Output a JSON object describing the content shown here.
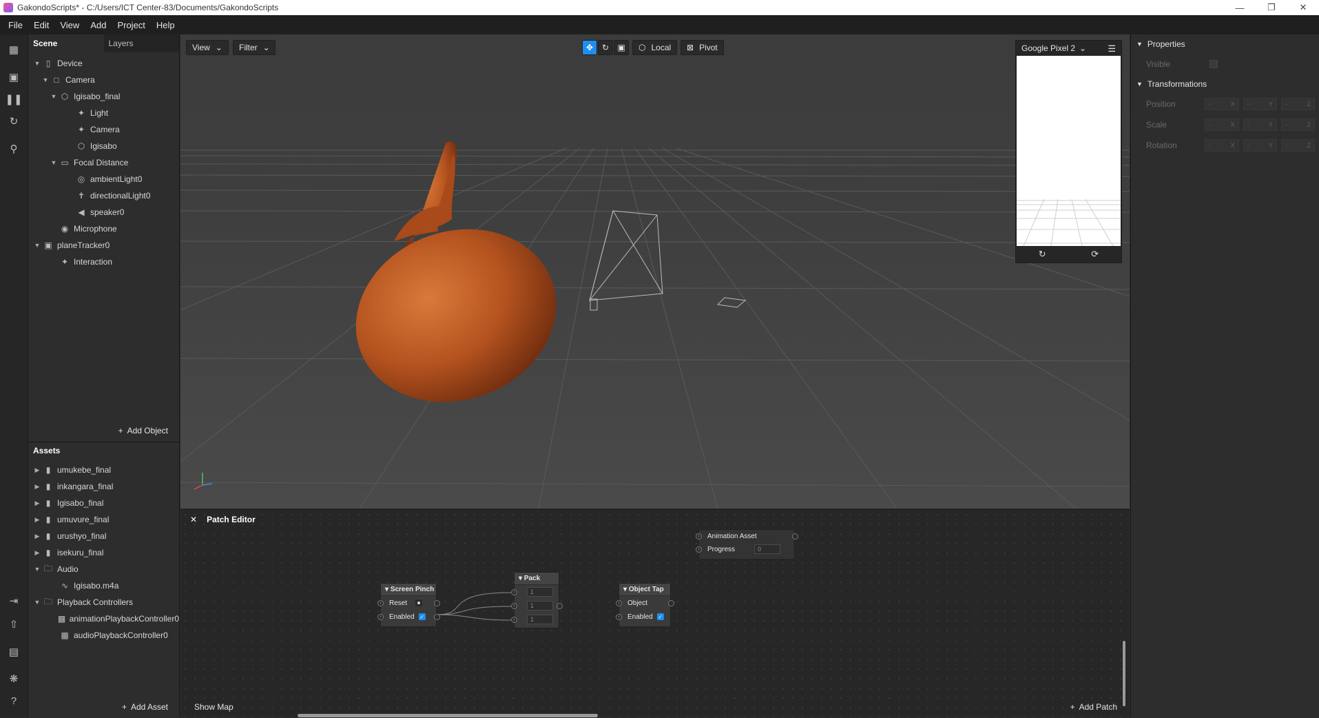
{
  "window": {
    "title": "GakondoScripts* - C:/Users/ICT Center-83/Documents/GakondoScripts"
  },
  "menu": [
    "File",
    "Edit",
    "View",
    "Add",
    "Project",
    "Help"
  ],
  "scene": {
    "tabs": [
      "Scene",
      "Layers"
    ],
    "tree": [
      {
        "label": "Device",
        "icon": "phone-icon"
      },
      {
        "label": "Camera",
        "icon": "camera-icon"
      },
      {
        "label": "Igisabo_final",
        "icon": "cube-icon"
      },
      {
        "label": "Light",
        "icon": "light-rig-icon"
      },
      {
        "label": "Camera",
        "icon": "camera-rig-icon"
      },
      {
        "label": "Igisabo",
        "icon": "mesh-icon"
      },
      {
        "label": "Focal Distance",
        "icon": "focal-distance-icon"
      },
      {
        "label": "ambientLight0",
        "icon": "ambient-light-icon"
      },
      {
        "label": "directionalLight0",
        "icon": "directional-light-icon"
      },
      {
        "label": "speaker0",
        "icon": "speaker-icon"
      },
      {
        "label": "Microphone",
        "icon": "microphone-icon"
      },
      {
        "label": "planeTracker0",
        "icon": "plane-tracker-icon"
      },
      {
        "label": "Interaction",
        "icon": "interaction-icon"
      }
    ],
    "add_object": "Add Object"
  },
  "assets": {
    "title": "Assets",
    "items": [
      {
        "label": "umukebe_final"
      },
      {
        "label": "inkangara_final"
      },
      {
        "label": "Igisabo_final"
      },
      {
        "label": "umuvure_final"
      },
      {
        "label": "urushyo_final"
      },
      {
        "label": "isekuru_final"
      },
      {
        "label": "Audio"
      },
      {
        "label": "Igisabo.m4a"
      },
      {
        "label": "Playback Controllers"
      },
      {
        "label": "animationPlaybackController0"
      },
      {
        "label": "audioPlaybackController0"
      }
    ],
    "add_asset": "Add Asset"
  },
  "viewport": {
    "view_label": "View",
    "filter_label": "Filter",
    "local_label": "Local",
    "pivot_label": "Pivot",
    "device_name": "Google Pixel 2"
  },
  "properties": {
    "title": "Properties",
    "visible_label": "Visible",
    "transformations_title": "Transformations",
    "rows": [
      {
        "label": "Position",
        "axes": [
          "X",
          "Y",
          "Z"
        ]
      },
      {
        "label": "Scale",
        "axes": [
          "X",
          "Y",
          "Z"
        ]
      },
      {
        "label": "Rotation",
        "axes": [
          "X",
          "Y",
          "Z"
        ]
      }
    ],
    "axis_placeholder": "-"
  },
  "patch_editor": {
    "title": "Patch Editor",
    "show_map": "Show Map",
    "add_patch": "Add Patch",
    "nodes": {
      "animation_asset": {
        "title": "Animation Asset",
        "progress_label": "Progress",
        "progress_value": "0"
      },
      "screen_pinch": {
        "title": "Screen Pinch",
        "reset_label": "Reset",
        "enabled_label": "Enabled"
      },
      "pack": {
        "title": "Pack",
        "values": [
          "1",
          "1",
          "1"
        ]
      },
      "object_tap": {
        "title": "Object Tap",
        "object_label": "Object",
        "enabled_label": "Enabled"
      }
    }
  },
  "colors": {
    "accent": "#1e8ef0",
    "gourd": "#b5531f",
    "background": "#2b2b2b"
  }
}
